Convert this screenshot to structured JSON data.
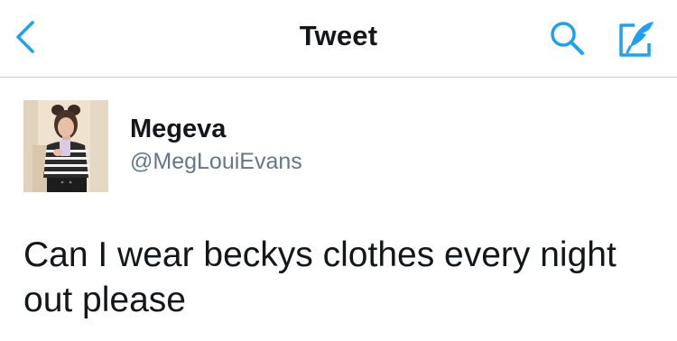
{
  "colors": {
    "accent": "#1da1f2",
    "text_primary": "#14171a",
    "text_secondary": "#657786",
    "divider": "#c8ccd0"
  },
  "navbar": {
    "title": "Tweet",
    "back_icon": "chevron-left-icon",
    "search_icon": "search-icon",
    "compose_icon": "compose-tweet-icon"
  },
  "tweet": {
    "author": {
      "display_name": "Megeva",
      "handle": "@MegLouiEvans",
      "avatar": "profile-photo"
    },
    "text": "Can I wear beckys clothes every night out please"
  }
}
